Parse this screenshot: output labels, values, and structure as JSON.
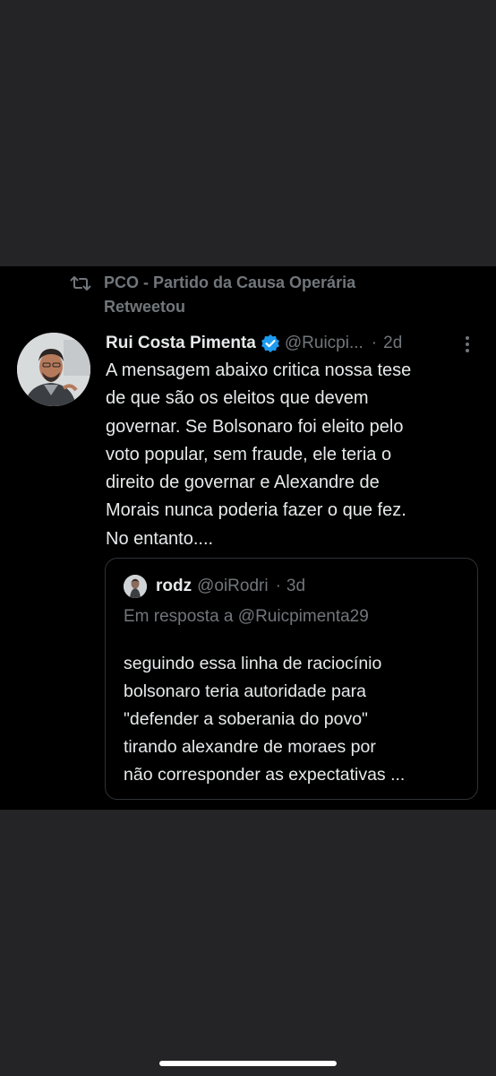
{
  "retweet": {
    "icon": "retweet-icon",
    "lines": [
      "PCO - Partido da Causa Operária",
      "Retweetou"
    ]
  },
  "tweet": {
    "author_name": "Rui Costa Pimenta",
    "verified_icon": "verified-badge-icon",
    "handle": "@Ruicpi...",
    "separator": "·",
    "time": "2d",
    "more_icon": "more-vertical-icon",
    "text_lines": [
      "A mensagem abaixo critica nossa tese",
      "de que são os eleitos que devem",
      "governar. Se Bolsonaro foi eleito pelo",
      "voto popular, sem fraude, ele teria o",
      "direito de governar e Alexandre de",
      "Morais nunca poderia fazer o que fez.",
      "No entanto...."
    ]
  },
  "quote": {
    "author_name": "rodz",
    "handle": "@oiRodri",
    "separator": "·",
    "time": "3d",
    "reply_to": "Em resposta a @Ruicpimenta29",
    "text_lines": [
      "seguindo essa linha de raciocínio",
      "bolsonaro teria autoridade para",
      "\"defender a soberania do povo\"",
      "tirando  alexandre de moraes por",
      "não corresponder as expectativas ..."
    ]
  },
  "colors": {
    "background": "#242426",
    "tweet_background": "#000000",
    "primary_text": "#e7e9ea",
    "secondary_text": "#71767b",
    "verified_blue": "#1d9bf0",
    "border": "#2f3336"
  }
}
